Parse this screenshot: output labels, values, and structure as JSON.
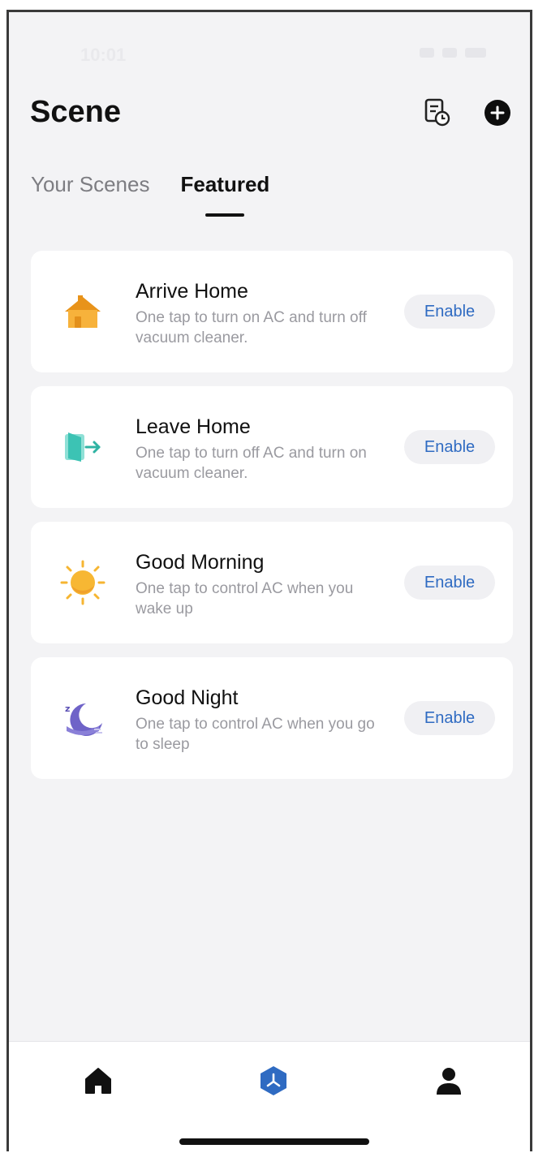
{
  "status_bar": {
    "time": "10:01"
  },
  "header": {
    "title": "Scene",
    "log_icon": "scene-log-icon",
    "add_icon": "add-circle-icon"
  },
  "tabs": [
    {
      "label": "Your Scenes",
      "active": false
    },
    {
      "label": "Featured",
      "active": true
    }
  ],
  "scenes": [
    {
      "title": "Arrive Home",
      "description": "One tap to turn on AC and turn off vacuum cleaner.",
      "icon": "house-icon",
      "action": "Enable"
    },
    {
      "title": "Leave Home",
      "description": "One tap to turn off AC and turn on vacuum cleaner.",
      "icon": "exit-door-icon",
      "action": "Enable"
    },
    {
      "title": "Good Morning",
      "description": "One tap to control AC when you wake up",
      "icon": "sun-icon",
      "action": "Enable"
    },
    {
      "title": "Good Night",
      "description": "One tap to control AC when you go to sleep",
      "icon": "moon-icon",
      "action": "Enable"
    }
  ],
  "bottom_nav": [
    {
      "icon": "home-icon",
      "active": false
    },
    {
      "icon": "scene-icon",
      "active": true
    },
    {
      "icon": "profile-icon",
      "active": false
    }
  ],
  "colors": {
    "accent": "#2f6bc2",
    "background": "#f3f3f5",
    "card": "#ffffff",
    "house_orange": "#f5a623",
    "door_teal": "#3cc3b4",
    "sun_yellow": "#f7b733",
    "moon_purple": "#6f63c8"
  }
}
